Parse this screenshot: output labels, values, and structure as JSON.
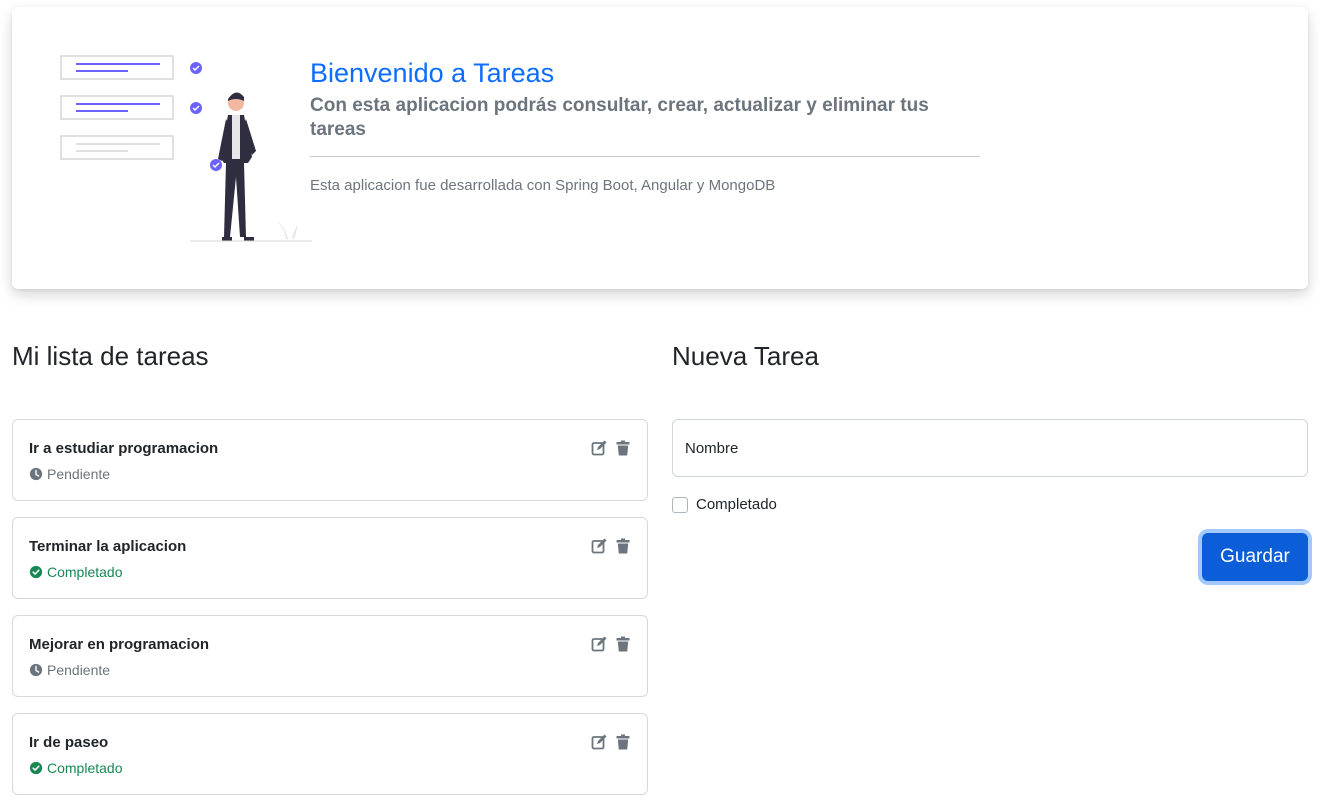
{
  "hero": {
    "title": "Bienvenido a Tareas",
    "subtitle": "Con esta aplicacion podrás consultar, crear, actualizar y eliminar tus tareas",
    "description": "Esta aplicacion fue desarrollada con Spring Boot, Angular y MongoDB",
    "illustration": "person-checklist-illustration"
  },
  "task_list": {
    "title": "Mi lista de tareas",
    "tasks": [
      {
        "name": "Ir a estudiar programacion",
        "status": "Pendiente",
        "status_icon": "clock-icon"
      },
      {
        "name": "Terminar la aplicacion",
        "status": "Completado",
        "status_icon": "check-circle-icon"
      },
      {
        "name": "Mejorar en programacion",
        "status": "Pendiente",
        "status_icon": "clock-icon"
      },
      {
        "name": "Ir de paseo",
        "status": "Completado",
        "status_icon": "check-circle-icon"
      }
    ],
    "actions": [
      "edit-icon",
      "trash-icon"
    ]
  },
  "form": {
    "title": "Nueva Tarea",
    "name_placeholder": "Nombre",
    "name_value": "",
    "checkbox_label": "Completado",
    "checkbox_checked": false,
    "submit_label": "Guardar"
  },
  "colors": {
    "primary": "#0d6efd",
    "button": "#0b5ed7",
    "muted": "#6c757d",
    "success": "#198754",
    "accent_illustration": "#6c63ff"
  }
}
